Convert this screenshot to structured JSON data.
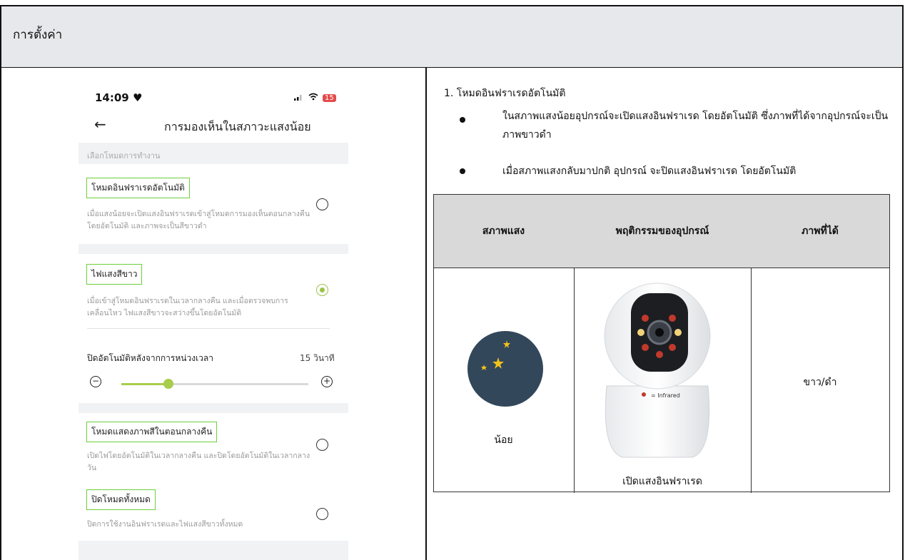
{
  "header": {
    "title": "การตั้งค่า"
  },
  "phone": {
    "time": "14:09",
    "battery": "15",
    "title": "การมองเห็นในสภาวะแสงน้อย",
    "section": "เลือกโหมดการทำงาน",
    "options": [
      {
        "label": "โหมดอินฟราเรดอัตโนมัติ",
        "desc": "เมื่อแสงน้อยจะเปิดแสงอินฟราเรดเข้าสู่โหมดการมองเห็นตอนกลางคืนโดยอัตโนมัติ และภาพจะเป็นสีขาวดำ",
        "selected": false
      },
      {
        "label": "ไฟแสงสีขาว",
        "desc": "เมื่อเข้าสู่โหมดอินฟราเรดในเวลากลางคืน และเมื่อตรวจพบการเคลื่อนไหว ไฟแสงสีขาวจะสว่างขึ้นโดยอัตโนมัติ",
        "selected": true
      },
      {
        "label": "โหมดแสดงภาพสีในตอนกลางคืน",
        "desc": "เปิดไฟโดยอัตโนมัติในเวลากลางคืน และปิดโดยอัตโนมัติในเวลากลางวัน",
        "selected": false
      },
      {
        "label": "ปิดโหมดทั้งหมด",
        "desc": "ปิดการใช้งานอินฟราเรดและไฟแสงสีขาวทั้งหมด",
        "selected": false
      }
    ],
    "delay": {
      "label": "ปิดอัตโนมัติหลังจากการหน่วงเวลา",
      "value": "15 วินาที",
      "level": 0.25
    }
  },
  "content": {
    "heading": "1. โหมดอินฟราเรดอัตโนมัติ",
    "bullets": [
      "ในสภาพแสงน้อยอุปกรณ์จะเปิดแสงอินฟราเรด โดยอัตโนมัติ ซึ่งภาพที่ได้จากอุปกรณ์จะเป็นภาพขาวดำ",
      "เมื่อสภาพแสงกลับมาปกติ อุปกรณ์ จะปิดแสงอินฟราเรด โดยอัตโนมัติ"
    ],
    "table": {
      "headers": [
        "สภาพแสง",
        "พฤติกรรมของอุปกรณ์",
        "ภาพที่ได้"
      ],
      "row": {
        "light": "น้อย",
        "behavior": "เปิดแสงอินฟราเรด",
        "result": "ขาว/ดำ",
        "camera_label": "= Infrared"
      }
    }
  },
  "colors": {
    "accent": "#a8cc4c",
    "label_border": "#6ccf3a",
    "header_bg": "#e7e8eb",
    "table_head_bg": "#d9d9d9"
  }
}
